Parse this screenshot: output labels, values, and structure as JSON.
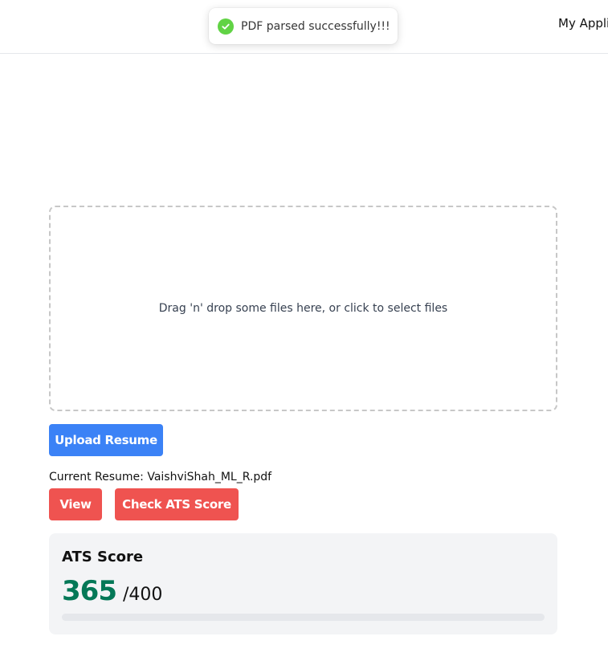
{
  "header": {
    "nav_link": "My Applic"
  },
  "toast": {
    "message": "PDF parsed successfully!!!",
    "icon": "check-circle-icon",
    "icon_color": "#61d345"
  },
  "dropzone": {
    "text": "Drag 'n' drop some files here, or click to select files"
  },
  "buttons": {
    "upload": "Upload Resume",
    "view": "View",
    "check_ats": "Check ATS Score"
  },
  "resume": {
    "current": "Current Resume: VaishviShah_ML_R.pdf"
  },
  "ats": {
    "title": "ATS Score",
    "score": "365",
    "max": "/400",
    "progress_percent": 0
  },
  "colors": {
    "primary_blue": "#3b82f6",
    "danger_red": "#ef5350",
    "score_green": "#047857",
    "card_bg": "#f3f4f6"
  }
}
